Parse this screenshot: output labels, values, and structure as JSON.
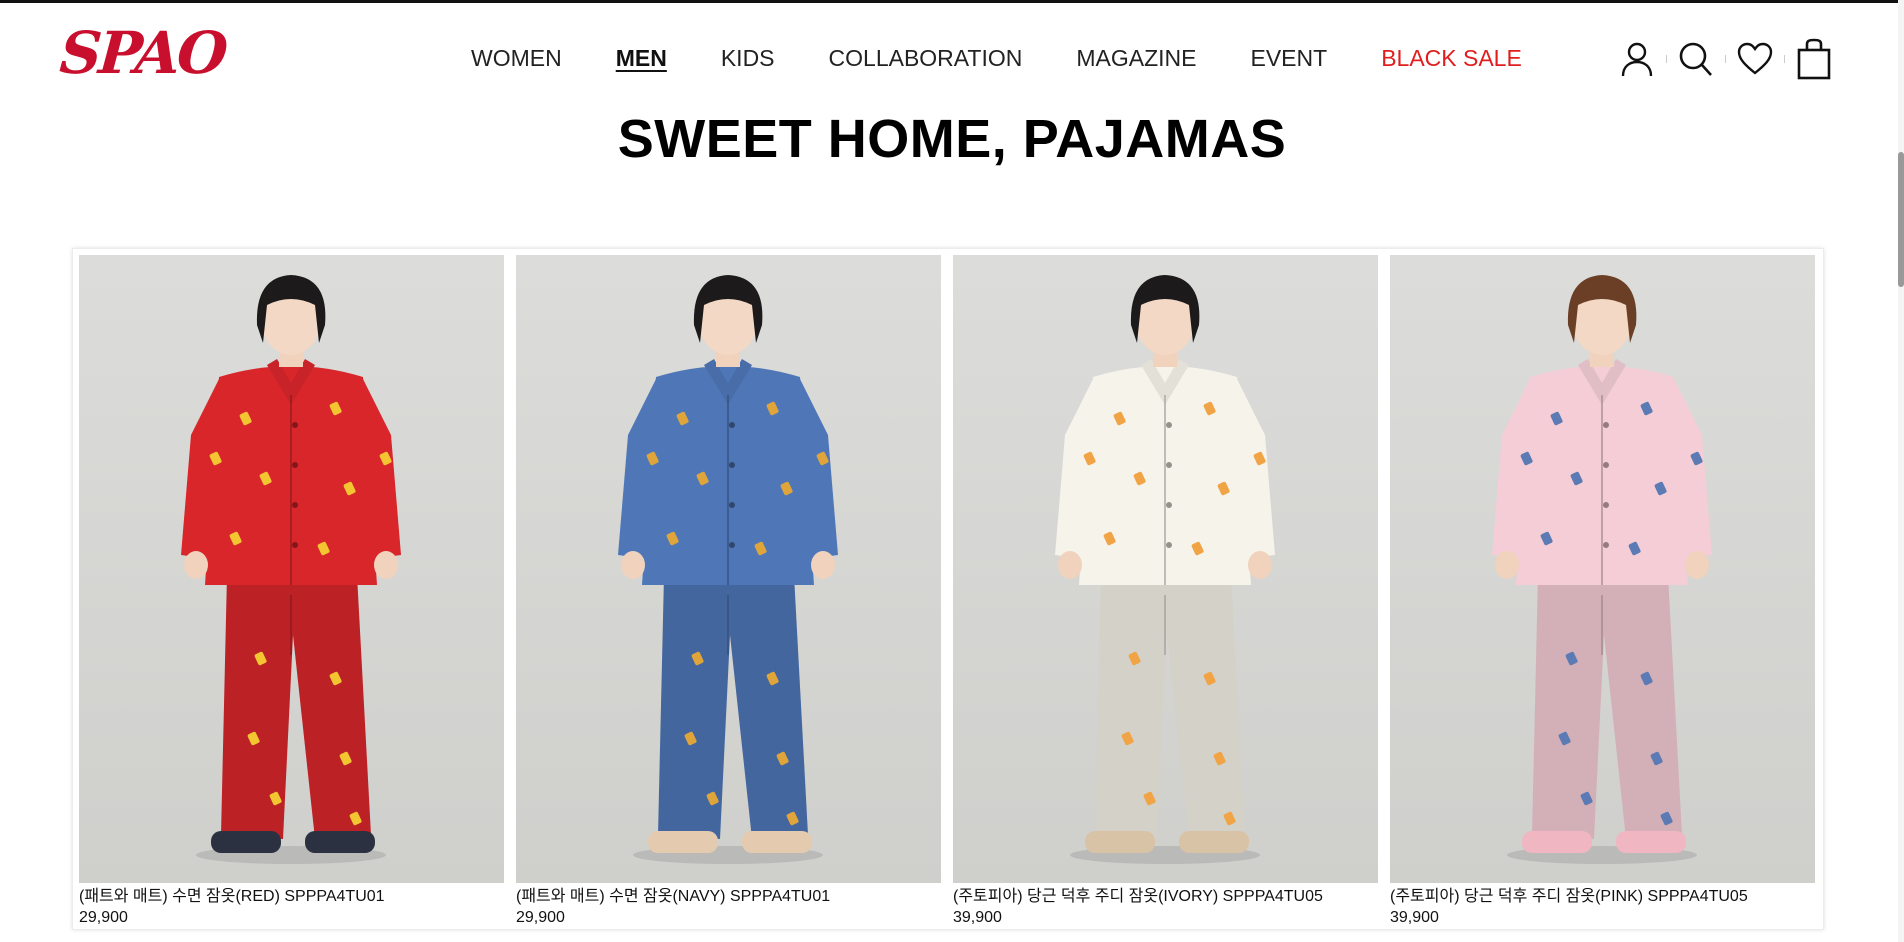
{
  "brand": {
    "logo_text": "SPAO",
    "color": "#c8102e"
  },
  "nav": {
    "items": [
      {
        "label": "WOMEN",
        "state": "normal"
      },
      {
        "label": "MEN",
        "state": "active"
      },
      {
        "label": "KIDS",
        "state": "normal"
      },
      {
        "label": "COLLABORATION",
        "state": "normal"
      },
      {
        "label": "MAGAZINE",
        "state": "normal"
      },
      {
        "label": "EVENT",
        "state": "normal"
      },
      {
        "label": "BLACK SALE",
        "state": "sale"
      }
    ]
  },
  "utility": {
    "icons": [
      "user-icon",
      "search-icon",
      "heart-icon",
      "shopping-bag-icon"
    ]
  },
  "section": {
    "title": "SWEET HOME, PAJAMAS"
  },
  "products": [
    {
      "name": "(패트와 매트) 수면 잠옷(RED) SPPPA4TU01",
      "price": "29,900",
      "color": "#d9262b",
      "hair": "#1c1a1a",
      "pattern": "#f2c531",
      "slippers": "#2b3140"
    },
    {
      "name": "(패트와 매트) 수면 잠옷(NAVY) SPPPA4TU01",
      "price": "29,900",
      "color": "#4f77b8",
      "hair": "#1c1a1a",
      "pattern": "#e0a53a",
      "slippers": "#e4cbb0"
    },
    {
      "name": "(주토피아) 당근 덕후 주디 잠옷(IVORY) SPPPA4TU05",
      "price": "39,900",
      "color": "#f6f3ea",
      "hair": "#1c1a1a",
      "pattern": "#f0a445",
      "slippers": "#d9c3a7"
    },
    {
      "name": "(주토피아) 당근 덕후 주디 잠옷(PINK) SPPPA4TU05",
      "price": "39,900",
      "color": "#f5cdd6",
      "hair": "#6b3f26",
      "pattern": "#5c7bb5",
      "slippers": "#f0b6c1"
    }
  ],
  "colors": {
    "sale": "#e01e1e",
    "background": "#ffffff",
    "photo_bg": "#d8d8d6"
  }
}
